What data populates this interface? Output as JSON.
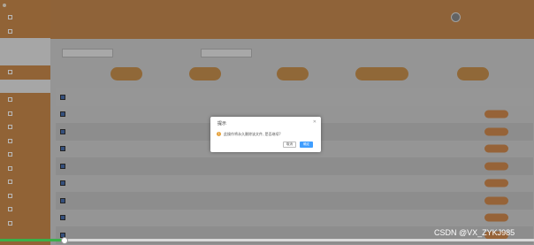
{
  "sidebar": {
    "header": "",
    "items": [
      {
        "label": ""
      },
      {
        "label": ""
      },
      {
        "label": "",
        "sub": true
      },
      {
        "label": "",
        "sub": true
      },
      {
        "label": ""
      },
      {
        "label": "",
        "sub": true
      },
      {
        "label": ""
      },
      {
        "label": ""
      },
      {
        "label": ""
      },
      {
        "label": ""
      },
      {
        "label": ""
      },
      {
        "label": ""
      },
      {
        "label": ""
      },
      {
        "label": ""
      },
      {
        "label": ""
      },
      {
        "label": ""
      }
    ]
  },
  "header": {
    "title": "",
    "username": ""
  },
  "search": {
    "field1_label": "",
    "field2_label": ""
  },
  "toolbar": {
    "buttons": [
      "",
      "",
      "",
      "",
      ""
    ]
  },
  "table": {
    "columns": [
      "",
      "",
      "",
      "",
      "",
      "",
      "",
      "",
      ""
    ],
    "rows": [
      [
        "",
        "",
        "",
        "",
        "",
        "",
        "",
        ""
      ],
      [
        "",
        "",
        "",
        "",
        "",
        "",
        "",
        ""
      ],
      [
        "",
        "",
        "",
        "",
        "",
        "",
        "",
        ""
      ],
      [
        "",
        "",
        "",
        "",
        "",
        "",
        "",
        ""
      ],
      [
        "",
        "",
        "",
        "",
        "",
        "",
        "",
        ""
      ],
      [
        "",
        "",
        "",
        "",
        "",
        "",
        "",
        ""
      ],
      [
        "",
        "",
        "",
        "",
        "",
        "",
        "",
        ""
      ],
      [
        "",
        "",
        "",
        "",
        "",
        "",
        "",
        ""
      ]
    ],
    "row_action": ""
  },
  "dialog": {
    "title": "提示",
    "message": "此操作将永久删除该文件, 是否继续?",
    "cancel_label": "取消",
    "ok_label": "确定",
    "close_icon": "close-icon",
    "warning_icon": "warning-icon"
  },
  "watermark": "CSDN @VX_ZYKJ985",
  "video": {
    "progress": 0.12
  },
  "colors": {
    "accent": "#c98a4c",
    "primary": "#409eff",
    "warning": "#e6a23c",
    "progress": "#3ab04a"
  }
}
